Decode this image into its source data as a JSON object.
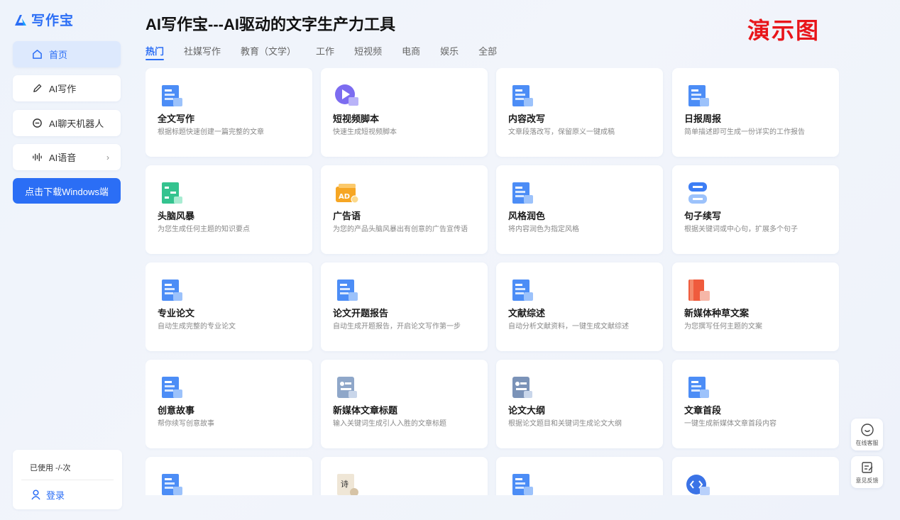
{
  "app": {
    "logo_text": "写作宝"
  },
  "sidebar": {
    "items": [
      {
        "label": "首页",
        "icon": "home-icon"
      },
      {
        "label": "AI写作",
        "icon": "pen-icon"
      },
      {
        "label": "AI聊天机器人",
        "icon": "chat-bubble-icon"
      },
      {
        "label": "AI语音",
        "icon": "audio-wave-icon"
      }
    ],
    "download_label": "点击下载Windows端",
    "usage_text": "已使用 -/-次",
    "login_label": "登录"
  },
  "header": {
    "title": "AI写作宝---AI驱动的文字生产力工具",
    "demo_label": "演示图"
  },
  "tabs": [
    "热门",
    "社媒写作",
    "教育（文学）",
    "工作",
    "短视频",
    "电商",
    "娱乐",
    "全部"
  ],
  "cards": [
    {
      "title": "全文写作",
      "desc": "根据标题快速创建一篇完整的文章",
      "icon": "document-write-icon"
    },
    {
      "title": "短视频脚本",
      "desc": "快速生成短视频脚本",
      "icon": "video-play-icon"
    },
    {
      "title": "内容改写",
      "desc": "文章段落改写，保留原义一键成稿",
      "icon": "rewrite-icon"
    },
    {
      "title": "日报周报",
      "desc": "简单描述即可生成一份详实的工作报告",
      "icon": "report-book-icon"
    },
    {
      "title": "头脑风暴",
      "desc": "为您生成任何主题的知识要点",
      "icon": "mindmap-icon"
    },
    {
      "title": "广告语",
      "desc": "为您的产品头脑风暴出有创意的广告宣传语",
      "icon": "ad-icon"
    },
    {
      "title": "风格润色",
      "desc": "将内容润色为指定风格",
      "icon": "folder-style-icon"
    },
    {
      "title": "句子续写",
      "desc": "根据关键词或中心句，扩展多个句子",
      "icon": "sentence-icon"
    },
    {
      "title": "专业论文",
      "desc": "自动生成完整的专业论文",
      "icon": "paper-icon"
    },
    {
      "title": "论文开题报告",
      "desc": "自动生成开题报告，开启论文写作第一步",
      "icon": "proposal-icon"
    },
    {
      "title": "文献综述",
      "desc": "自动分析文献资料，一键生成文献综述",
      "icon": "literature-icon"
    },
    {
      "title": "新媒体种草文案",
      "desc": "为您撰写任何主题的文案",
      "icon": "red-book-icon"
    },
    {
      "title": "创意故事",
      "desc": "帮你续写创意故事",
      "icon": "story-icon"
    },
    {
      "title": "新媒体文章标题",
      "desc": "输入关键词生成引人入胜的文章标题",
      "icon": "headline-icon"
    },
    {
      "title": "论文大纲",
      "desc": "根据论文题目和关键词生成论文大纲",
      "icon": "outline-icon"
    },
    {
      "title": "文章首段",
      "desc": "一键生成新媒体文章首段内容",
      "icon": "first-paragraph-icon"
    },
    {
      "title": "",
      "desc": "",
      "icon": "chart-6s-icon"
    },
    {
      "title": "",
      "desc": "",
      "icon": "poem-icon"
    },
    {
      "title": "",
      "desc": "",
      "icon": "doc-blue-icon"
    },
    {
      "title": "",
      "desc": "",
      "icon": "code-icon"
    }
  ],
  "float_buttons": [
    {
      "label": "在线客服",
      "icon": "customer-service-icon"
    },
    {
      "label": "意见反馈",
      "icon": "feedback-icon"
    }
  ],
  "colors": {
    "accent": "#2b6ef5",
    "demo_red": "#e8151a"
  }
}
